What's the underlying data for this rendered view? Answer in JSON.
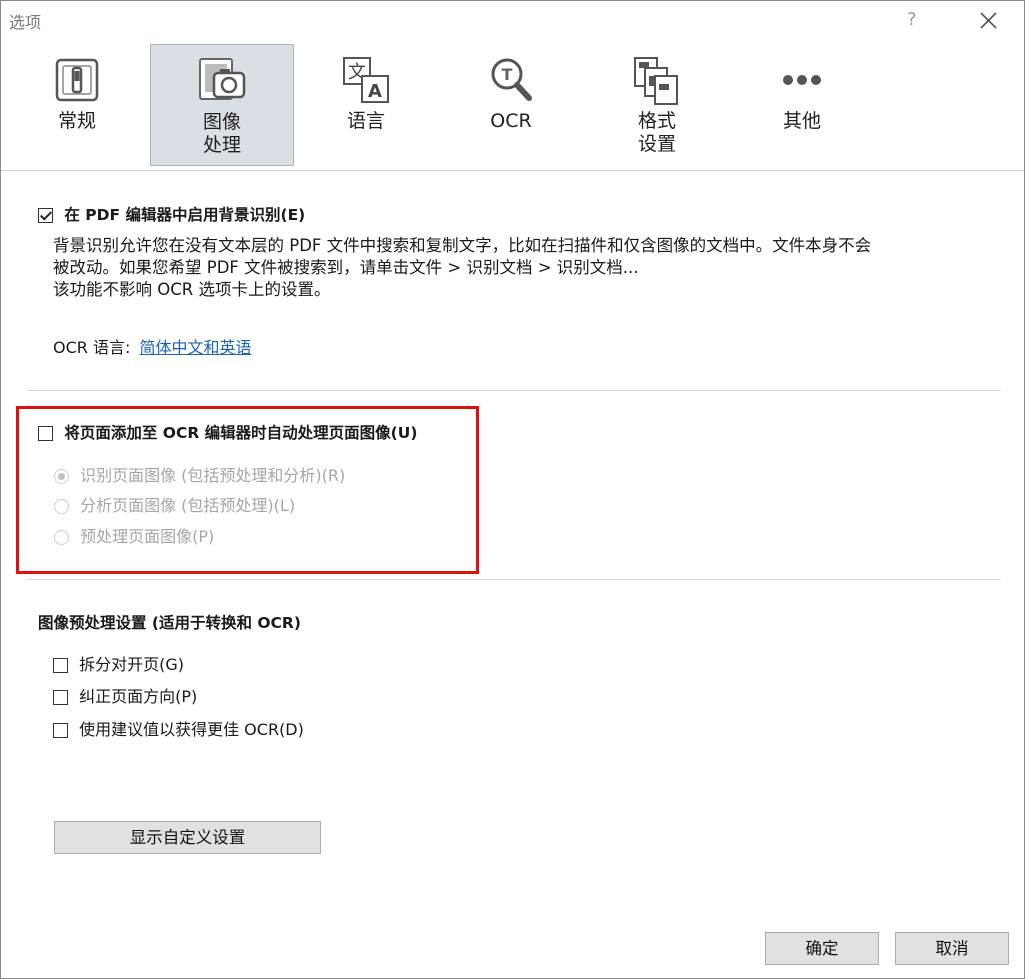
{
  "window": {
    "title": "选项",
    "help_label": "?"
  },
  "toolbar": {
    "tabs": [
      {
        "label": "常规",
        "label2": ""
      },
      {
        "label": "图像",
        "label2": "处理"
      },
      {
        "label": "语言",
        "label2": ""
      },
      {
        "label": "OCR",
        "label2": ""
      },
      {
        "label": "格式",
        "label2": "设置"
      },
      {
        "label": "其他",
        "label2": ""
      }
    ],
    "active_tab": 1
  },
  "background_recognition": {
    "checkbox_label": "在 PDF 编辑器中启用背景识别(E)",
    "checked": true,
    "description_line1": "背景识别允许您在没有文本层的 PDF 文件中搜索和复制文字，比如在扫描件和仅含图像的文档中。文件本身不会",
    "description_line2": "被改动。如果您希望 PDF 文件被搜索到，请单击文件 > 识别文档 > 识别文档...",
    "description_line3": "该功能不影响 OCR 选项卡上的设置。",
    "ocr_language_label": "OCR 语言:",
    "ocr_language_link": "简体中文和英语"
  },
  "auto_process": {
    "checkbox_label": "将页面添加至 OCR 编辑器时自动处理页面图像(U)",
    "checked": false,
    "options": [
      {
        "label": "识别页面图像 (包括预处理和分析)(R)",
        "selected": true
      },
      {
        "label": "分析页面图像 (包括预处理)(L)",
        "selected": false
      },
      {
        "label": "预处理页面图像(P)",
        "selected": false
      }
    ]
  },
  "preprocessing": {
    "heading": "图像预处理设置 (适用于转换和 OCR)",
    "options": [
      {
        "label": "拆分对开页(G)",
        "checked": false
      },
      {
        "label": "纠正页面方向(P)",
        "checked": false
      },
      {
        "label": "使用建议值以获得更佳 OCR(D)",
        "checked": false
      }
    ],
    "custom_button": "显示自定义设置"
  },
  "footer": {
    "ok": "确定",
    "cancel": "取消"
  },
  "colors": {
    "highlight": "#e01010",
    "link": "#1a64b4",
    "active_tab_bg": "#d9dfe4"
  }
}
